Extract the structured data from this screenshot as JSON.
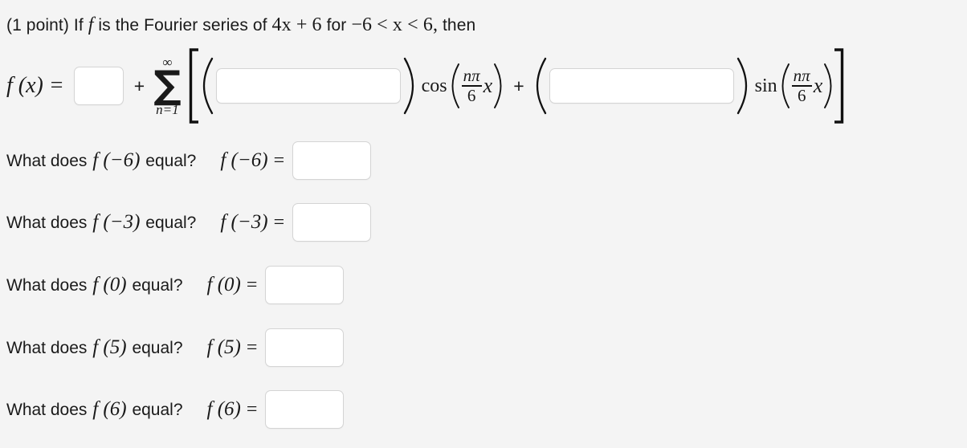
{
  "problem": {
    "points_label": "(1 point)",
    "statement_pre": "If",
    "statement_fn": "f",
    "statement_mid": "is the Fourier series of",
    "statement_expr": "4x + 6",
    "statement_for": "for",
    "statement_domain": "−6 < x < 6,",
    "statement_end": "then"
  },
  "formula": {
    "lhs": "f (x) =",
    "a0_input_value": "",
    "a0_input_placeholder": "",
    "plus": "+",
    "sigma_glyph": "∑",
    "sigma_upper": "∞",
    "sigma_lower": "n=1",
    "open_bracket": "[",
    "close_bracket": "]",
    "open_paren": "(",
    "close_paren": ")",
    "an_input_value": "",
    "an_input_placeholder": "",
    "bn_input_value": "",
    "bn_input_placeholder": "",
    "cos_label": "cos",
    "sin_label": "sin",
    "frac_numerator": "nπ",
    "frac_denominator": "6",
    "variable": "x",
    "plus_mid": "+"
  },
  "questions": [
    {
      "prompt_pre": "What does",
      "prompt_fn": "f (−6)",
      "prompt_post": "equal?",
      "answer_label": "f (−6)",
      "equals": "=",
      "answer_value": "",
      "answer_placeholder": ""
    },
    {
      "prompt_pre": "What does",
      "prompt_fn": "f (−3)",
      "prompt_post": "equal?",
      "answer_label": "f (−3)",
      "equals": "=",
      "answer_value": "",
      "answer_placeholder": ""
    },
    {
      "prompt_pre": "What does",
      "prompt_fn": "f (0)",
      "prompt_post": "equal?",
      "answer_label": "f (0)",
      "equals": "=",
      "answer_value": "",
      "answer_placeholder": ""
    },
    {
      "prompt_pre": "What does",
      "prompt_fn": "f (5)",
      "prompt_post": "equal?",
      "answer_label": "f (5)",
      "equals": "=",
      "answer_value": "",
      "answer_placeholder": ""
    },
    {
      "prompt_pre": "What does",
      "prompt_fn": "f (6)",
      "prompt_post": "equal?",
      "answer_label": "f (6)",
      "equals": "=",
      "answer_value": "",
      "answer_placeholder": ""
    }
  ],
  "colors": {
    "page_background": "#f4f4f4",
    "text": "#1a1a1a",
    "input_background": "#ffffff",
    "input_border": "#d4d4d4"
  }
}
